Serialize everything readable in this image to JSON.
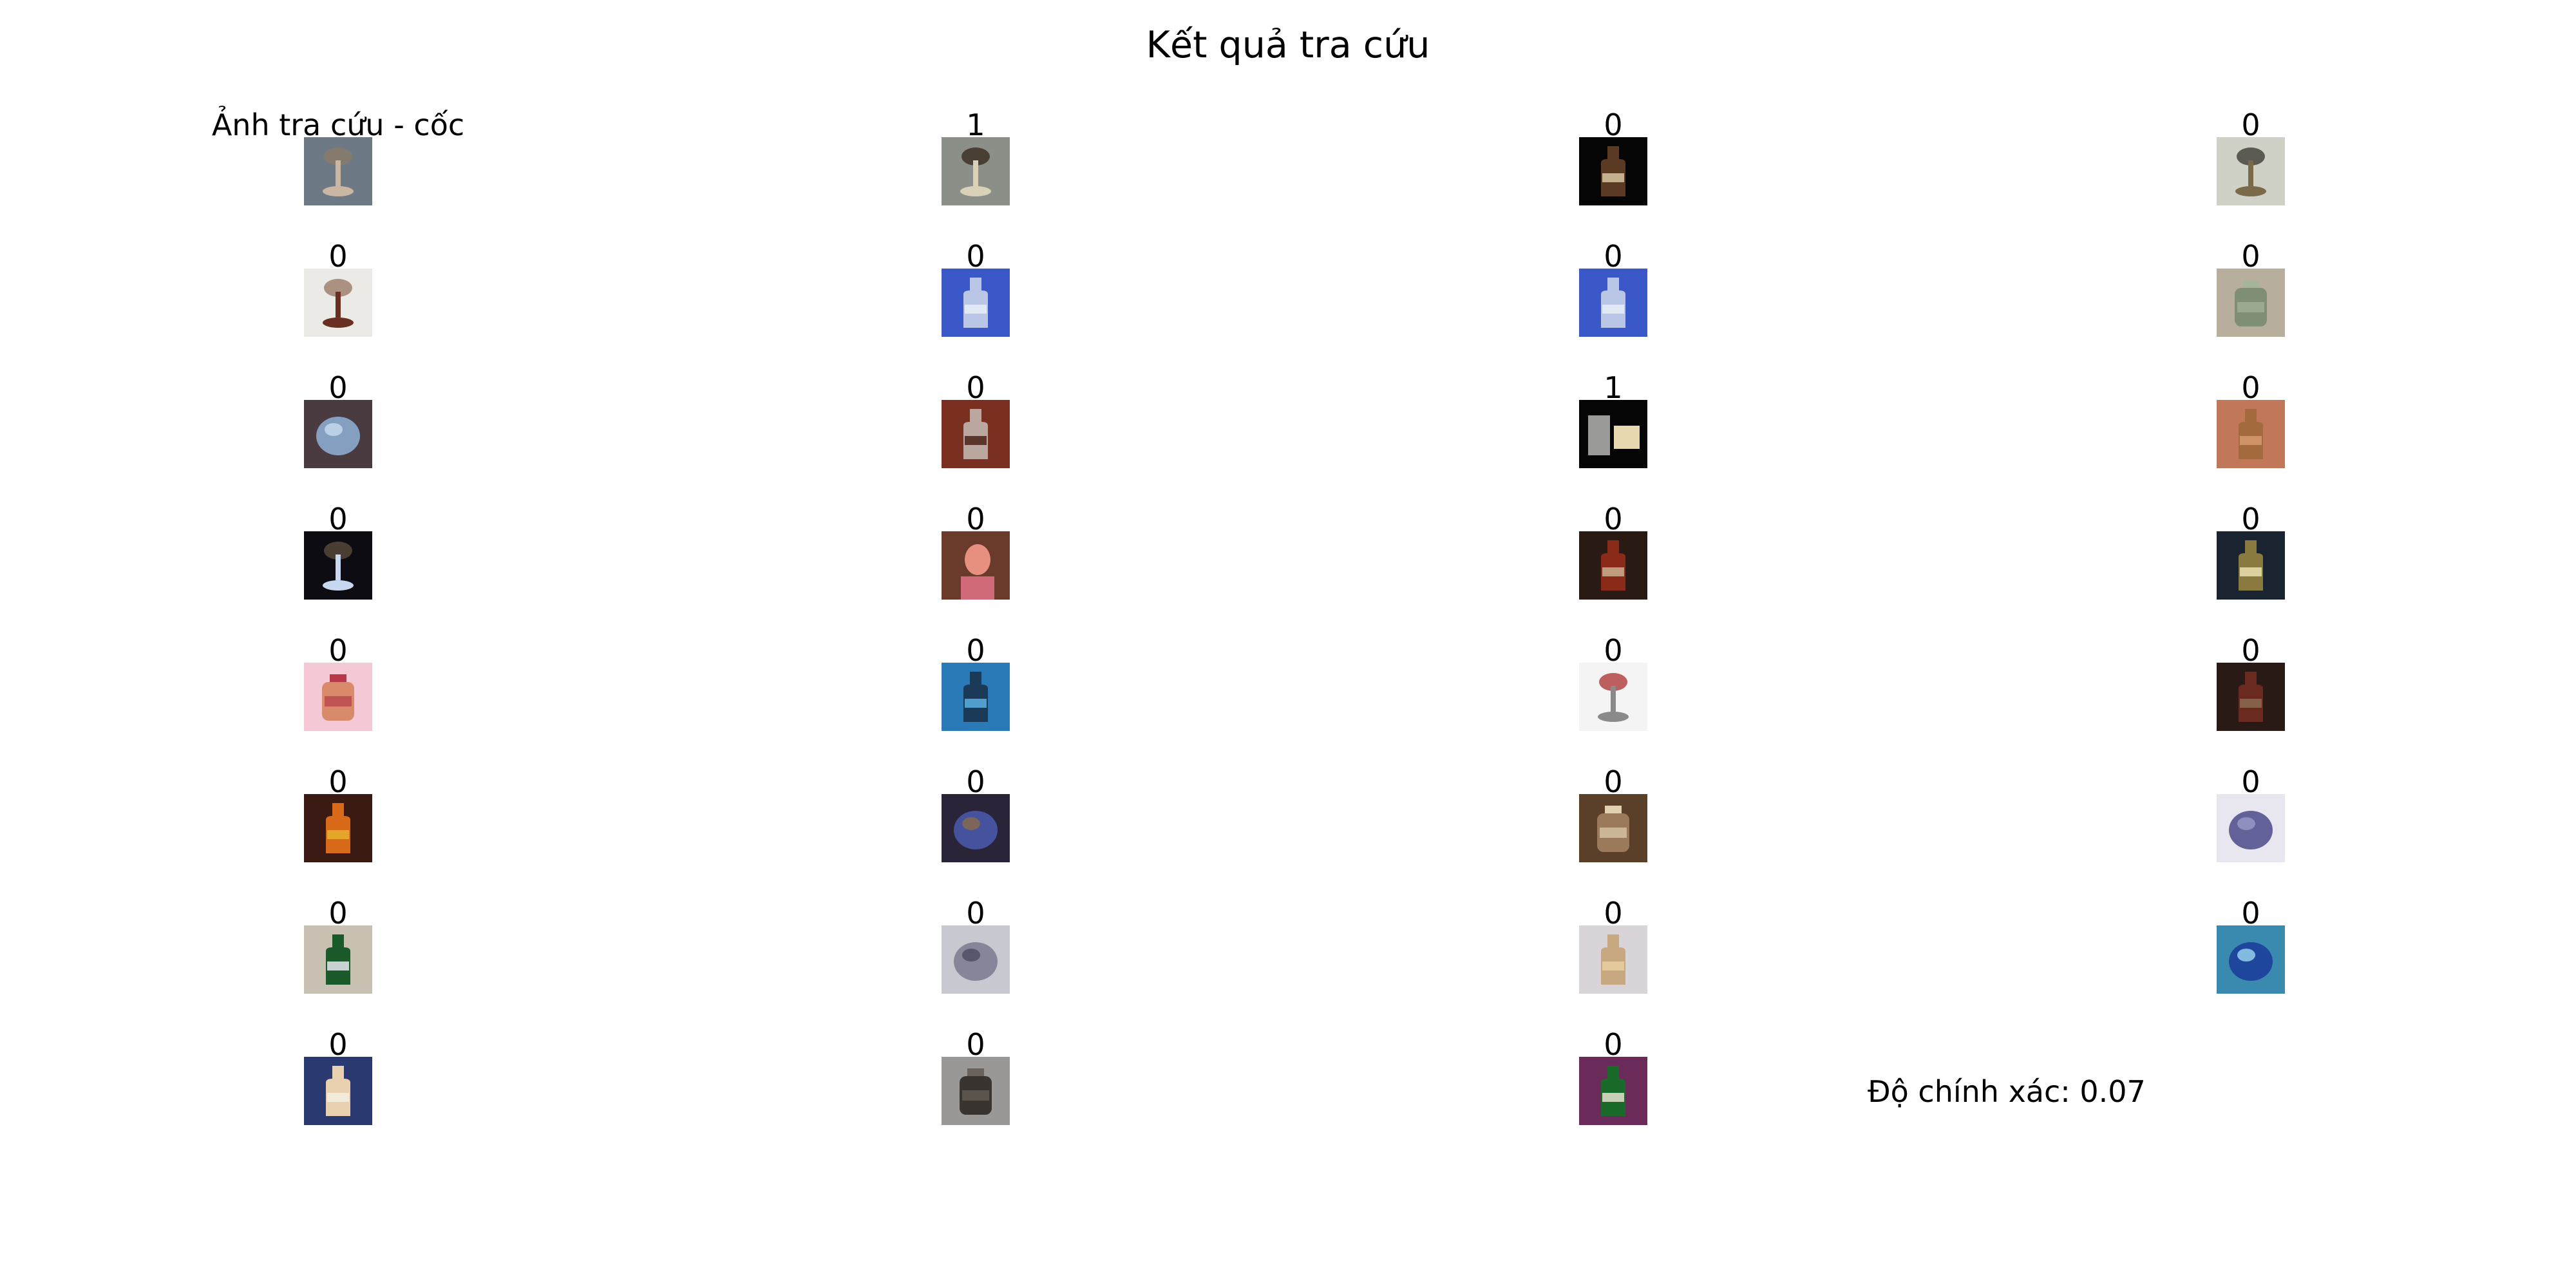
{
  "title": "Kết quả tra cứu",
  "query_label": "Ảnh tra cứu - cốc",
  "accuracy_text": "Độ chính xác: 0.07",
  "results": [
    [
      "1",
      "0",
      "0"
    ],
    [
      "0",
      "0",
      "0",
      "0"
    ],
    [
      "0",
      "0",
      "1",
      "0"
    ],
    [
      "0",
      "0",
      "0",
      "0"
    ],
    [
      "0",
      "0",
      "0",
      "0"
    ],
    [
      "0",
      "0",
      "0",
      "0"
    ],
    [
      "0",
      "0",
      "0",
      "0"
    ],
    [
      "0",
      "0",
      "0"
    ]
  ]
}
